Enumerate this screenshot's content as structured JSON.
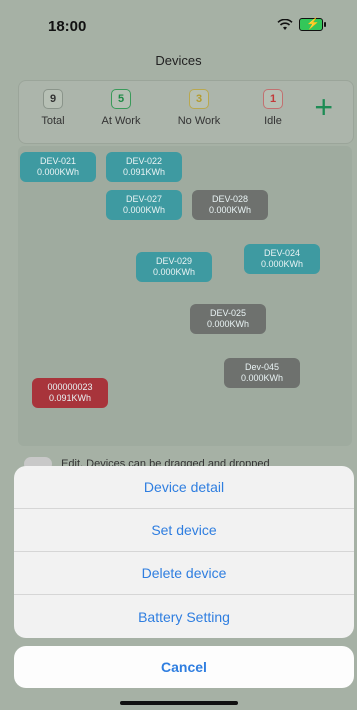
{
  "status": {
    "time": "18:00",
    "wifi_icon": "wifi-icon",
    "battery_icon": "battery-charging-icon"
  },
  "header": {
    "title": "Devices"
  },
  "stats": {
    "items": [
      {
        "value": "9",
        "label": "Total",
        "color": "#333333"
      },
      {
        "value": "5",
        "label": "At Work",
        "color": "#1f8a46"
      },
      {
        "value": "3",
        "label": "No Work",
        "color": "#b39b2e"
      },
      {
        "value": "1",
        "label": "Idle",
        "color": "#c23a3a"
      }
    ],
    "add_icon": "plus-icon",
    "add_label": "+"
  },
  "devices": [
    {
      "name": "DEV-021",
      "energy": "0.000KWh",
      "status": "teal"
    },
    {
      "name": "DEV-022",
      "energy": "0.091KWh",
      "status": "teal"
    },
    {
      "name": "DEV-027",
      "energy": "0.000KWh",
      "status": "teal"
    },
    {
      "name": "DEV-028",
      "energy": "0.000KWh",
      "status": "grey"
    },
    {
      "name": "DEV-029",
      "energy": "0.000KWh",
      "status": "teal"
    },
    {
      "name": "DEV-024",
      "energy": "0.000KWh",
      "status": "teal"
    },
    {
      "name": "DEV-025",
      "energy": "0.000KWh",
      "status": "grey"
    },
    {
      "name": "Dev-045",
      "energy": "0.000KWh",
      "status": "grey"
    },
    {
      "name": "000000023",
      "energy": "0.091KWh",
      "status": "red"
    }
  ],
  "edit": {
    "label": "Edit, Devices can be dragged and dropped"
  },
  "sheet": {
    "actions": [
      "Device detail",
      "Set device",
      "Delete device",
      "Battery Setting"
    ],
    "cancel": "Cancel"
  },
  "colors": {
    "accent": "#2f7ee0",
    "teal": "#3e9aa1",
    "grey": "#6e716e",
    "red": "#a8343b"
  }
}
